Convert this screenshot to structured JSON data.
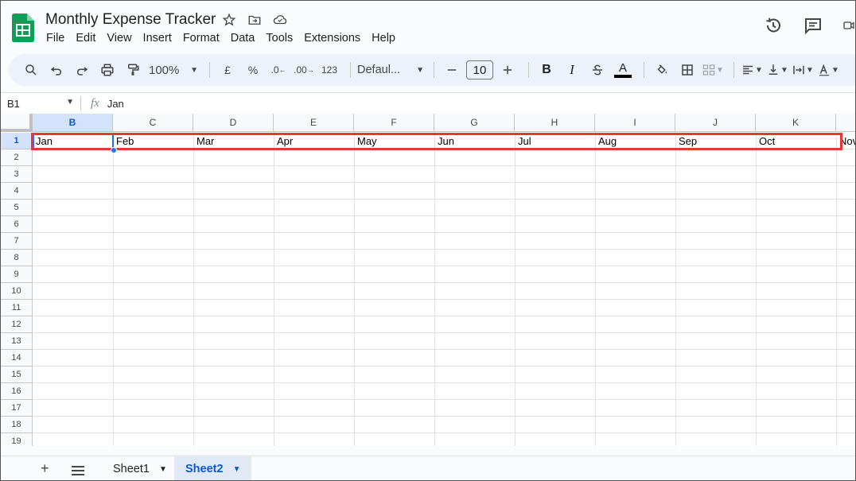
{
  "app": {
    "title": "Monthly Expense Tracker",
    "menu": [
      "File",
      "Edit",
      "View",
      "Insert",
      "Format",
      "Data",
      "Tools",
      "Extensions",
      "Help"
    ]
  },
  "toolbar": {
    "zoom": "100%",
    "currency": "£",
    "percent": "%",
    "decrease_decimal": ".0",
    "increase_decimal": ".00",
    "number_format": "123",
    "font": "Defaul...",
    "font_size": "10",
    "bold": "B",
    "italic": "I",
    "text_color_letter": "A"
  },
  "formula_bar": {
    "cell_ref": "B1",
    "fx": "fx",
    "value": "Jan"
  },
  "grid": {
    "columns": [
      "B",
      "C",
      "D",
      "E",
      "F",
      "G",
      "H",
      "I",
      "J",
      "K"
    ],
    "rows": [
      "1",
      "2",
      "3",
      "4",
      "5",
      "6",
      "7",
      "8",
      "9",
      "10",
      "11",
      "12",
      "13",
      "14",
      "15",
      "16",
      "17",
      "18",
      "19"
    ],
    "row1_values": [
      "Jan",
      "Feb",
      "Mar",
      "Apr",
      "May",
      "Jun",
      "Jul",
      "Aug",
      "Sep",
      "Oct",
      "Nov"
    ],
    "selected_column": "B",
    "selected_row": "1"
  },
  "sheets": {
    "tabs": [
      "Sheet1",
      "Sheet2"
    ],
    "active": "Sheet2"
  },
  "colors": {
    "accent": "#0b57d0",
    "highlight_border": "#e53935",
    "sheets_green": "#0f9d58"
  }
}
